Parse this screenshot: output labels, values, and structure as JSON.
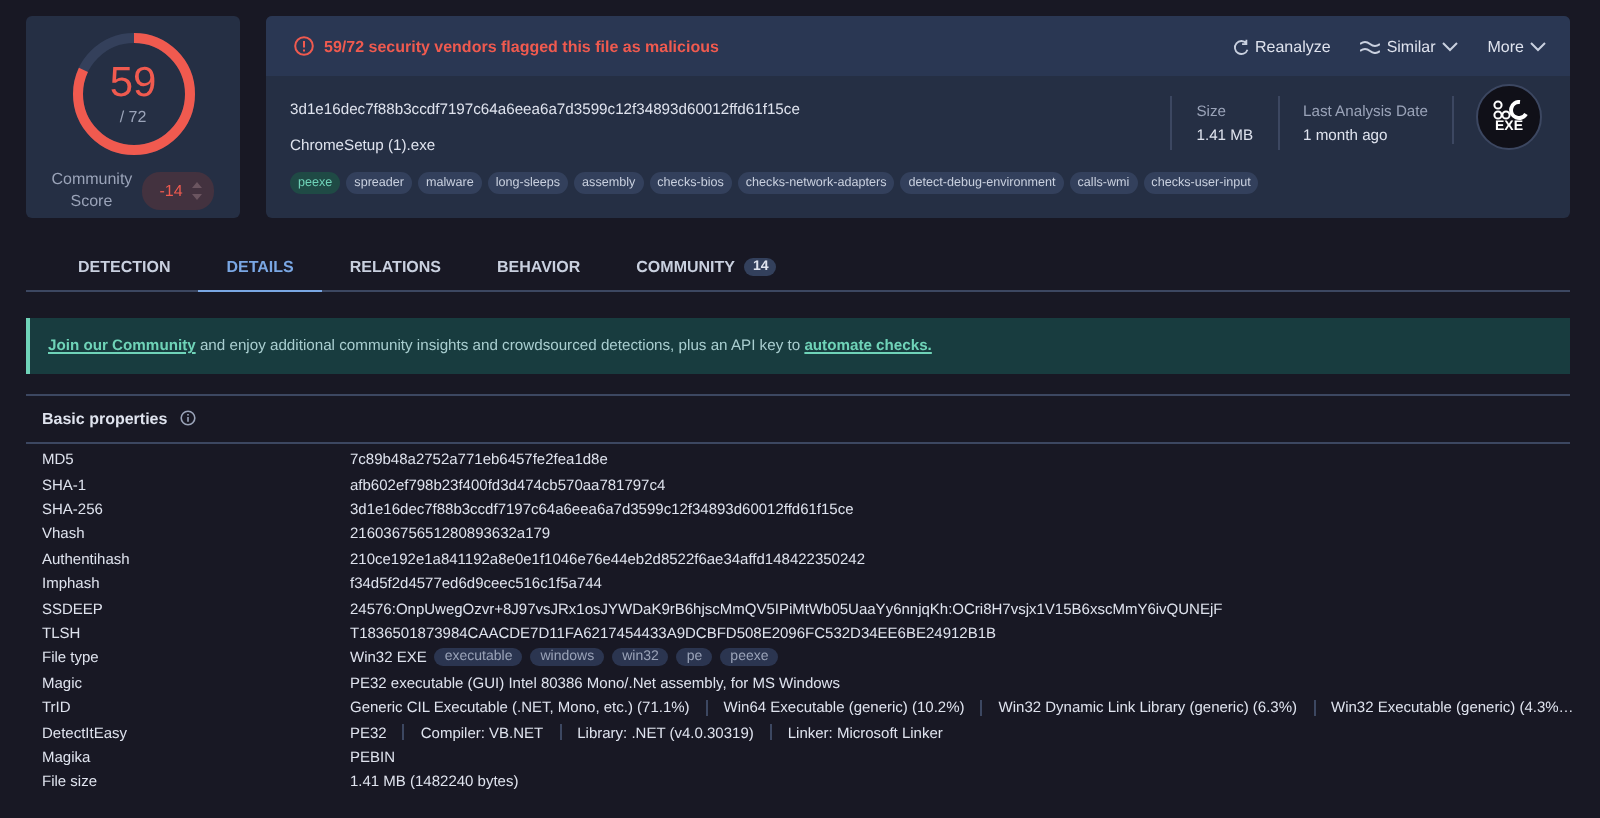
{
  "score": {
    "detections": "59",
    "total": "/ 72",
    "community_label": "Community Score",
    "community_value": "-14"
  },
  "alert": "59/72 security vendors flagged this file as malicious",
  "actions": [
    {
      "label": "Reanalyze",
      "kind": "reanalyze"
    },
    {
      "label": "Similar",
      "kind": "similar"
    },
    {
      "label": "More",
      "kind": "more"
    }
  ],
  "file": {
    "hash": "3d1e16dec7f88b3ccdf7197c64a6eea6a7d3599c12f34893d60012ffd61f15ce",
    "name": "ChromeSetup (1).exe",
    "size_label": "Size",
    "size": "1.41 MB",
    "date_label": "Last Analysis Date",
    "date": "1 month ago",
    "badge": "EXE"
  },
  "tags": [
    {
      "label": "peexe",
      "kind": "filetype"
    },
    {
      "label": "spreader",
      "kind": "behavior"
    },
    {
      "label": "malware",
      "kind": "behavior"
    },
    {
      "label": "long-sleeps",
      "kind": "behavior"
    },
    {
      "label": "assembly",
      "kind": "behavior"
    },
    {
      "label": "checks-bios",
      "kind": "behavior"
    },
    {
      "label": "checks-network-adapters",
      "kind": "behavior"
    },
    {
      "label": "detect-debug-environment",
      "kind": "behavior"
    },
    {
      "label": "calls-wmi",
      "kind": "behavior"
    },
    {
      "label": "checks-user-input",
      "kind": "behavior"
    }
  ],
  "tabs": [
    {
      "label": "DETECTION",
      "selected": false
    },
    {
      "label": "DETAILS",
      "selected": true
    },
    {
      "label": "RELATIONS",
      "selected": false
    },
    {
      "label": "BEHAVIOR",
      "selected": false
    },
    {
      "label": "COMMUNITY",
      "selected": false,
      "count": "14"
    }
  ],
  "banner": [
    {
      "text": "Join our Community",
      "link": true
    },
    {
      "text": " and enjoy additional community insights and crowdsourced detections, plus an API key to ",
      "link": false
    },
    {
      "text": "automate checks.",
      "link": true
    }
  ],
  "section": {
    "title": "Basic properties",
    "rows": [
      {
        "label": "MD5",
        "kind": "text",
        "value": "7c89b48a2752a771eb6457fe2fea1d8e"
      },
      {
        "label": "SHA-1",
        "kind": "text",
        "value": "afb602ef798b23f400fd3d474cb570aa781797c4"
      },
      {
        "label": "SHA-256",
        "kind": "text",
        "value": "3d1e16dec7f88b3ccdf7197c64a6eea6a7d3599c12f34893d60012ffd61f15ce"
      },
      {
        "label": "Vhash",
        "kind": "text",
        "value": "21603675651280893632a179"
      },
      {
        "label": "Authentihash",
        "kind": "text",
        "value": "210ce192e1a841192a8e0e1f1046e76e44eb2d8522f6ae34affd148422350242"
      },
      {
        "label": "Imphash",
        "kind": "text",
        "value": "f34d5f2d4577ed6d9ceec516c1f5a744"
      },
      {
        "label": "SSDEEP",
        "kind": "text",
        "value": "24576:OnpUwegOzvr+8J97vsJRx1osJYWDaK9rB6hjscMmQV5IPiMtWb05UaaYy6nnjqKh:OCri8H7vsjx1V15B6xscMmY6ivQUNEjF"
      },
      {
        "label": "TLSH",
        "kind": "text",
        "value": "T1836501873984CAACDE7D11FA6217454433A9DCBFD508E2096FC532D34EE6BE24912B1B"
      },
      {
        "label": "File type",
        "kind": "tags",
        "value": "Win32 EXE",
        "tags": [
          "executable",
          "windows",
          "win32",
          "pe",
          "peexe"
        ]
      },
      {
        "label": "Magic",
        "kind": "text",
        "value": "PE32 executable (GUI) Intel 80386 Mono/.Net assembly, for MS Windows"
      },
      {
        "label": "TrID",
        "kind": "parts",
        "parts": [
          "Generic CIL Executable (.NET, Mono, etc.) (71.1%)",
          "Win64 Executable (generic) (10.2%)",
          "Win32 Dynamic Link Library (generic) (6.3%)",
          "Win32 Executable (generic) (4.3%…"
        ]
      },
      {
        "label": "DetectItEasy",
        "kind": "parts",
        "parts": [
          "PE32",
          "Compiler: VB.NET",
          "Library: .NET (v4.0.30319)",
          "Linker: Microsoft Linker"
        ]
      },
      {
        "label": "Magika",
        "kind": "text",
        "value": "PEBIN"
      },
      {
        "label": "File size",
        "kind": "text",
        "value": "1.41 MB (1482240 bytes)"
      }
    ]
  }
}
